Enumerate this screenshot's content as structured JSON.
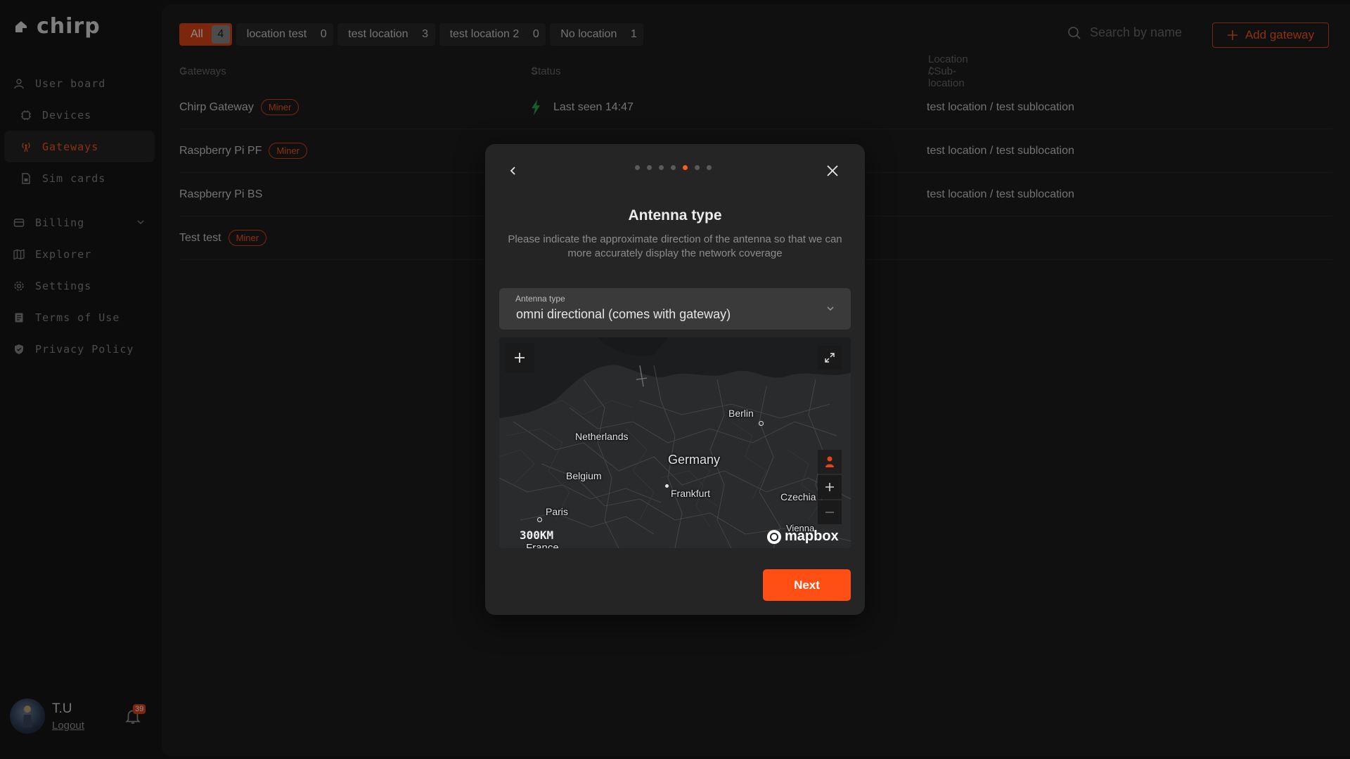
{
  "app": {
    "name": "chirp"
  },
  "sidebar": {
    "items": [
      {
        "label": "User board",
        "icon": "user-icon"
      },
      {
        "label": "Devices",
        "icon": "chip-icon"
      },
      {
        "label": "Gateways",
        "icon": "antenna-icon",
        "active": true
      },
      {
        "label": "Sim cards",
        "icon": "sim-card-icon"
      },
      {
        "label": "Billing",
        "icon": "billing-icon"
      },
      {
        "label": "Explorer",
        "icon": "map-icon"
      },
      {
        "label": "Settings",
        "icon": "gear-icon"
      },
      {
        "label": "Terms of Use",
        "icon": "document-icon"
      },
      {
        "label": "Privacy Policy",
        "icon": "shield-icon"
      }
    ],
    "user": {
      "name": "T.U",
      "logout": "Logout",
      "notifications": "39"
    }
  },
  "filters": [
    {
      "label": "All",
      "count": "4"
    },
    {
      "label": "location test",
      "count": "0"
    },
    {
      "label": "test location",
      "count": "3"
    },
    {
      "label": "test location 2",
      "count": "0"
    },
    {
      "label": "No location",
      "count": "1"
    }
  ],
  "search": {
    "placeholder": "Search by name"
  },
  "add_button": "Add gateway",
  "table": {
    "headers": {
      "gateways": "Gateways",
      "status": "Status",
      "location": "Location / Sub-location"
    },
    "rows": [
      {
        "name": "Chirp Gateway",
        "badge": "Miner",
        "status": "Last seen 14:47",
        "location": "test location / test sublocation"
      },
      {
        "name": "Raspberry Pi PF",
        "badge": "Miner",
        "status": "",
        "location": "test location / test sublocation"
      },
      {
        "name": "Raspberry Pi BS",
        "badge": "",
        "status": "",
        "location": "test location / test sublocation"
      },
      {
        "name": "Test test",
        "badge": "Miner",
        "status": "",
        "location": ""
      }
    ]
  },
  "modal": {
    "title": "Antenna type",
    "description": "Please indicate the approximate direction of the antenna so that we can more accurately display the network coverage",
    "steps_total": 7,
    "step_current": 5,
    "select": {
      "label": "Antenna type",
      "value": "omni directional (comes with gateway)"
    },
    "map": {
      "labels": {
        "berlin": "Berlin",
        "netherlands": "Netherlands",
        "germany": "Germany",
        "belgium": "Belgium",
        "frankfurt": "Frankfurt",
        "czechia": "Czechia",
        "paris": "Paris",
        "vienna": "Vienna",
        "france": "France"
      },
      "scale": "300KM",
      "attribution": "mapbox"
    },
    "next": "Next"
  },
  "colors": {
    "accent": "#ff4f14",
    "background": "#161616",
    "panel": "#1e1e1e",
    "modal": "#252525"
  }
}
